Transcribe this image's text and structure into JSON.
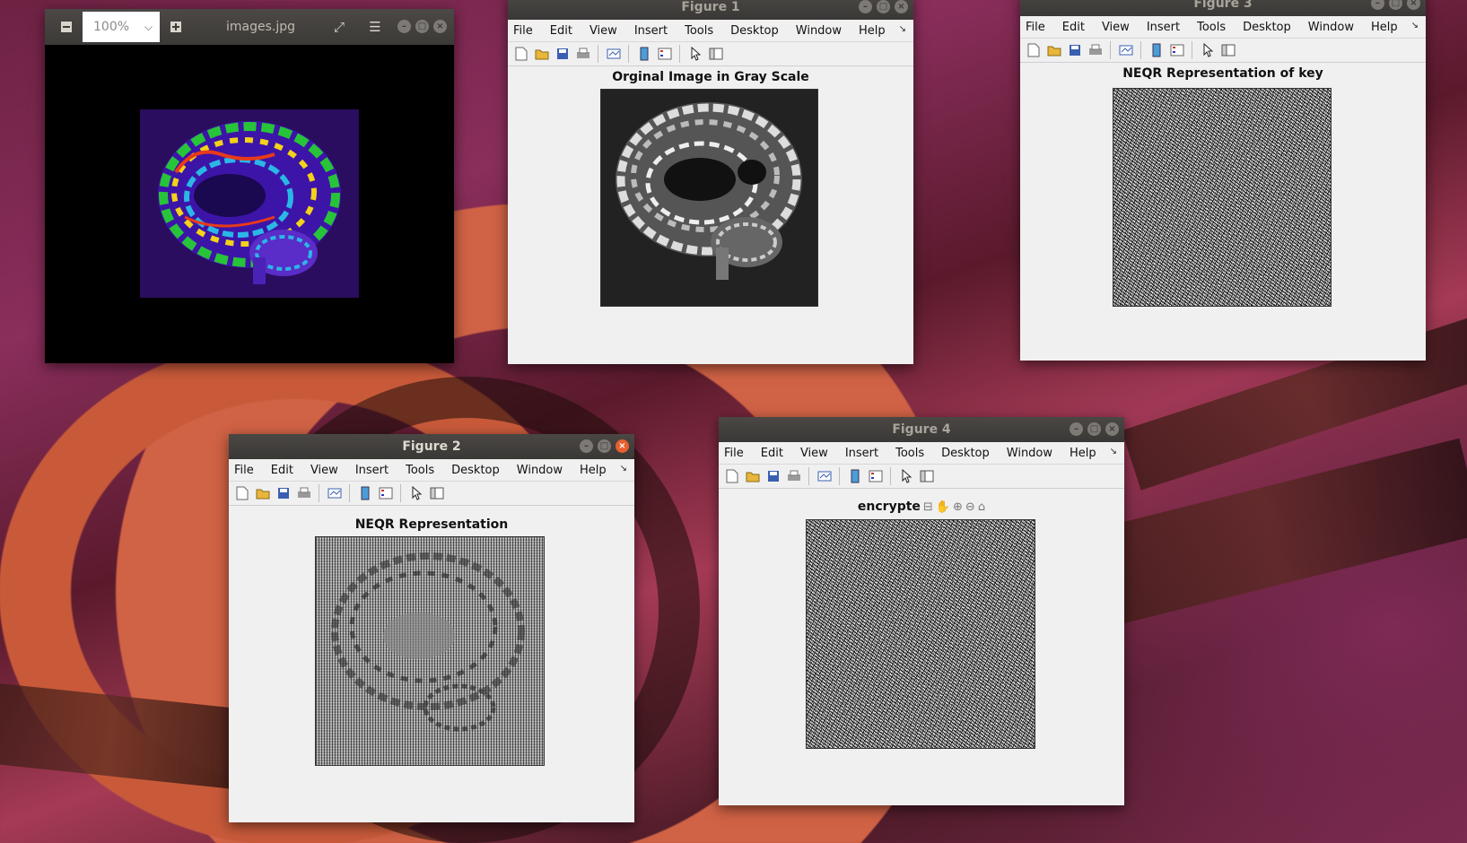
{
  "image_viewer": {
    "filename": "images.jpg",
    "zoom": "100%",
    "zoom_out_icon": "minus-icon",
    "zoom_in_icon": "plus-icon",
    "fullscreen_icon": "fullscreen-icon",
    "menu_icon": "hamburger-menu-icon"
  },
  "menu_labels": [
    "File",
    "Edit",
    "View",
    "Insert",
    "Tools",
    "Desktop",
    "Window",
    "Help"
  ],
  "toolbar_icons": [
    "new-figure-icon",
    "open-file-icon",
    "save-icon",
    "print-icon",
    "link-plot-icon",
    "insert-colorbar-icon",
    "insert-legend-icon",
    "edit-plot-arrow-icon",
    "plot-tools-icon"
  ],
  "axes_toolbar_icons": [
    "brush-icon",
    "pan-hand-icon",
    "zoom-in-icon",
    "zoom-out-icon",
    "home-icon"
  ],
  "figure1": {
    "title": "Figure 1",
    "plot_title": "Orginal Image in Gray Scale"
  },
  "figure2": {
    "title": "Figure 2",
    "plot_title": "NEQR Representation"
  },
  "figure3": {
    "title": "Figure 3",
    "plot_title": "NEQR Representation of key"
  },
  "figure4": {
    "title": "Figure 4",
    "plot_title": "encrypte"
  },
  "colors": {
    "titlebar": "#3e3c39",
    "close_active": "#e8602e",
    "panel": "#f0f0f0"
  }
}
